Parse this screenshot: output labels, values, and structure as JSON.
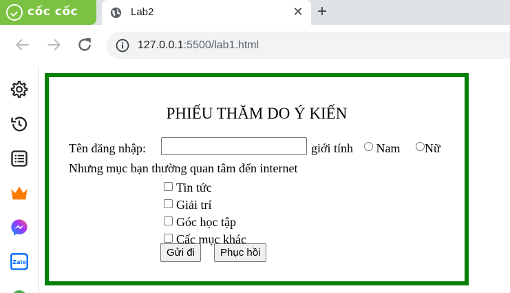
{
  "browser": {
    "brand_name": "cốc cốc",
    "tab": {
      "title": "Lab2",
      "close_glyph": "✕"
    },
    "new_tab_glyph": "+",
    "address": {
      "host": "127.0.0.1",
      "rest": ":5500/lab1.html"
    },
    "sidebar_icons": [
      "settings-icon",
      "history-icon",
      "reading-list-icon",
      "crown-icon",
      "messenger-icon",
      "zalo-icon",
      "extension-icon"
    ],
    "zalo_label": "Zalo"
  },
  "form": {
    "title": "PHIẾU THĂM DO Ý KIẾN",
    "username_label": "Tên đăng nhập:",
    "gender_label": "giới tính",
    "gender_options": [
      "Nam",
      "Nữ"
    ],
    "interests_label": "Nhưng mục bạn thường quan tâm đến internet",
    "interests": [
      "Tin tức",
      "Giải trí",
      "Góc học tập",
      "Cấc mục khác"
    ],
    "submit_label": "Gửi đi",
    "reset_label": "Phục hồi"
  },
  "colors": {
    "form_border": "#008000",
    "brand": "#7cc242"
  }
}
